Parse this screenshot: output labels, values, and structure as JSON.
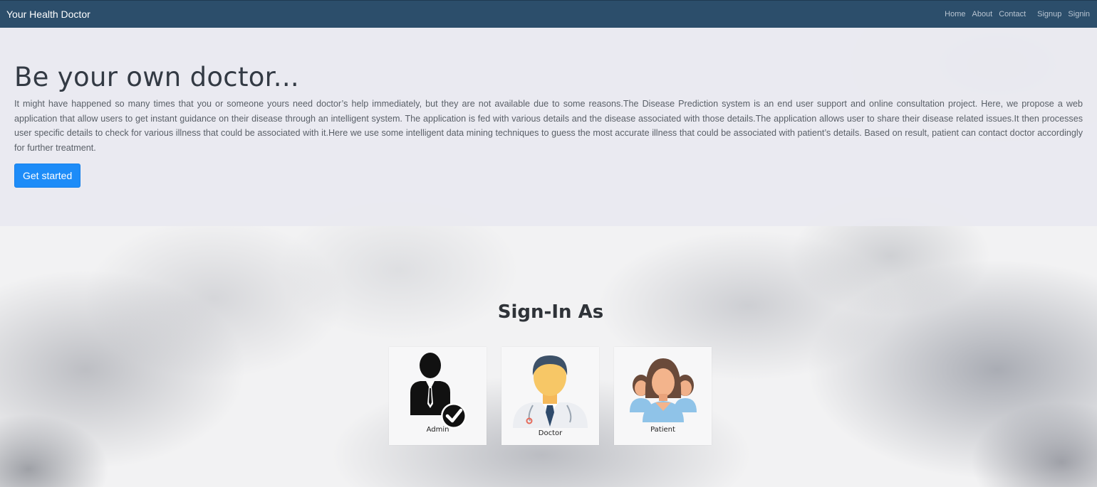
{
  "navbar": {
    "brand": "Your Health Doctor",
    "links": [
      "Home",
      "About",
      "Contact",
      "Signup",
      "Signin"
    ]
  },
  "hero": {
    "title": "Be your own doctor...",
    "text": "It might have happened so many times that you or someone yours need doctor’s help immediately, but they are not available due to some reasons.The Disease Prediction system is an end user support and online consultation project. Here, we propose a web application that allow users to get instant guidance on their disease through an intelligent system. The application is fed with various details and the disease associated with those details.The application allows user to share their disease related issues.It then processes user specific details to check for various illness that could be associated with it.Here we use some intelligent data mining techniques to guess the most accurate illness that could be associated with patient’s details. Based on result, patient can contact doctor accordingly for further treatment.",
    "button": "Get started"
  },
  "signin": {
    "title": "Sign-In As",
    "roles": [
      {
        "label": "Admin",
        "icon": "admin-icon"
      },
      {
        "label": "Doctor",
        "icon": "doctor-icon"
      },
      {
        "label": "Patient",
        "icon": "patient-icon"
      }
    ]
  },
  "colors": {
    "navbar": "#2c4e6b",
    "button": "#1d8cf8",
    "hero_bg": "#e9eaef"
  }
}
